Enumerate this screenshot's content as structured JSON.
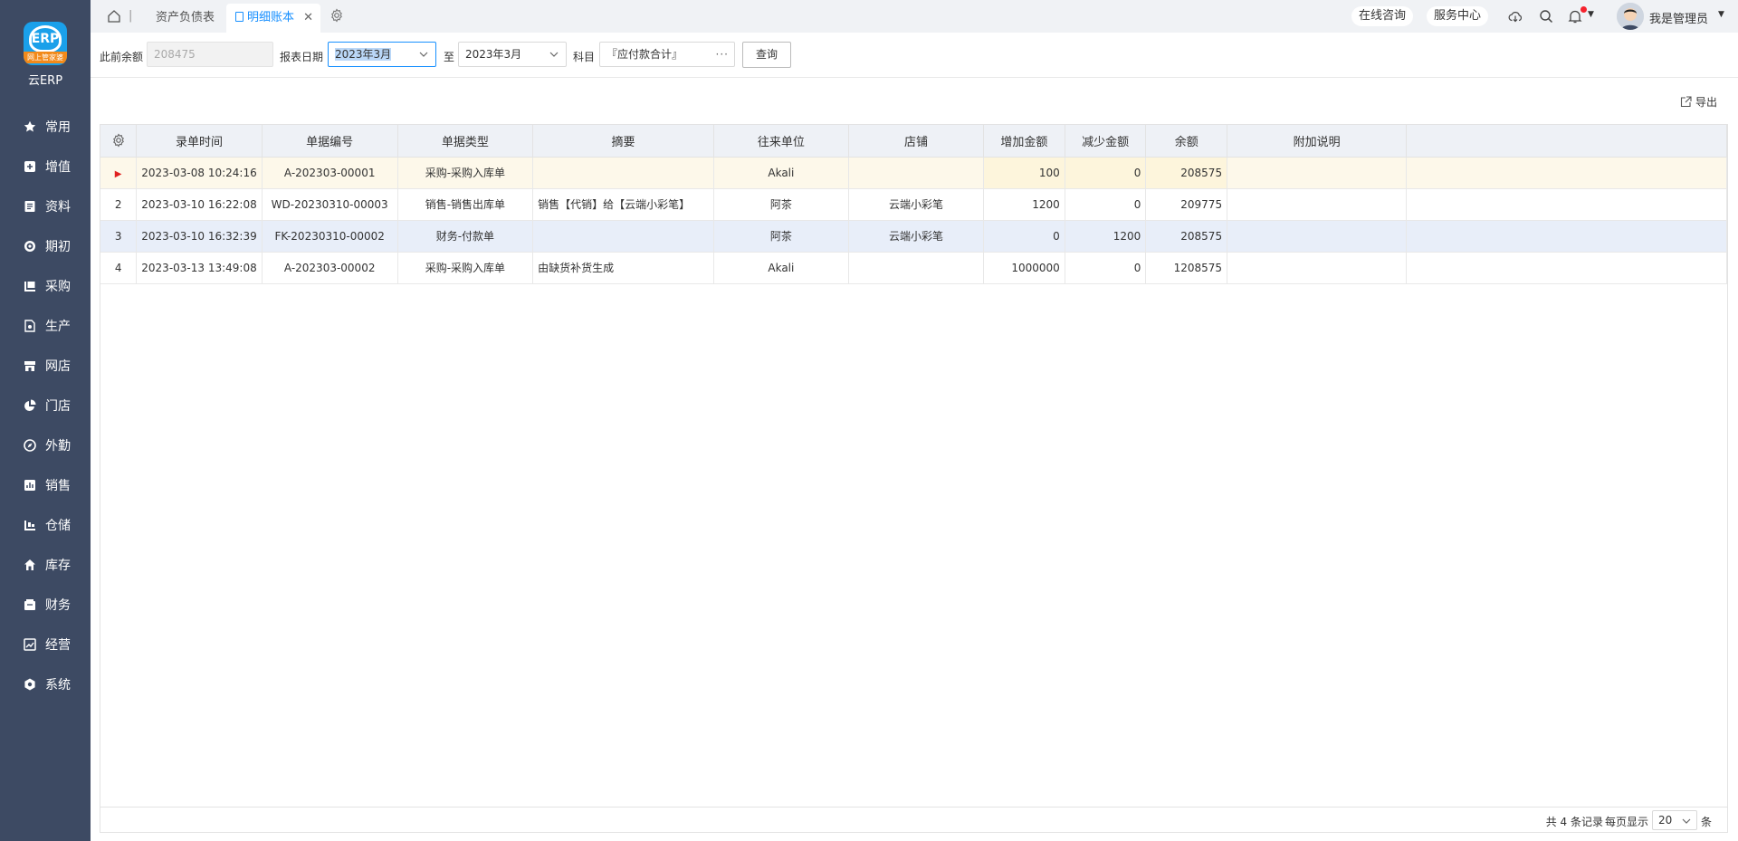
{
  "app": {
    "logo_ribbon": "网上管家婆",
    "logo_mark": "ERP",
    "name": "云ERP"
  },
  "sidebar": {
    "items": [
      {
        "label": "常用",
        "icon": "star-icon"
      },
      {
        "label": "增值",
        "icon": "plus-square-icon"
      },
      {
        "label": "资料",
        "icon": "document-icon"
      },
      {
        "label": "期初",
        "icon": "target-icon"
      },
      {
        "label": "采购",
        "icon": "purchase-icon"
      },
      {
        "label": "生产",
        "icon": "production-icon"
      },
      {
        "label": "网店",
        "icon": "store-icon"
      },
      {
        "label": "门店",
        "icon": "pie-icon"
      },
      {
        "label": "外勤",
        "icon": "compass-icon"
      },
      {
        "label": "销售",
        "icon": "chart-icon"
      },
      {
        "label": "仓储",
        "icon": "warehouse-icon"
      },
      {
        "label": "库存",
        "icon": "home-icon"
      },
      {
        "label": "财务",
        "icon": "finance-icon"
      },
      {
        "label": "经营",
        "icon": "business-icon"
      },
      {
        "label": "系统",
        "icon": "settings-icon"
      }
    ]
  },
  "topbar": {
    "tabs": [
      {
        "label": "资产负债表"
      },
      {
        "label": "明细账本",
        "active": true
      }
    ],
    "consult": "在线咨询",
    "service": "服务中心",
    "user_name": "我是管理员"
  },
  "filters": {
    "prev_balance_label": "此前余额",
    "prev_balance_value": "208475",
    "date_label": "报表日期",
    "date_from": "2023年3月",
    "to_label": "至",
    "date_to": "2023年3月",
    "subject_label": "科目",
    "subject_value": "『应付款合计』",
    "query": "查询"
  },
  "export_label": "导出",
  "table": {
    "columns": [
      "录单时间",
      "单据编号",
      "单据类型",
      "摘要",
      "往来单位",
      "店铺",
      "增加金额",
      "减少金额",
      "余额",
      "附加说明"
    ],
    "rows": [
      {
        "idx": "▶",
        "time": "2023-03-08 10:24:16",
        "no": "A-202303-00001",
        "type": "采购-采购入库单",
        "summary": "",
        "partner": "Akali",
        "shop": "",
        "inc": "100",
        "dec": "0",
        "balance": "208575",
        "note": ""
      },
      {
        "idx": "2",
        "time": "2023-03-10 16:22:08",
        "no": "WD-20230310-00003",
        "type": "销售-销售出库单",
        "summary": "销售【代销】给【云端小彩笔】",
        "partner": "阿茶",
        "shop": "云端小彩笔",
        "inc": "1200",
        "dec": "0",
        "balance": "209775",
        "note": ""
      },
      {
        "idx": "3",
        "time": "2023-03-10 16:32:39",
        "no": "FK-20230310-00002",
        "type": "财务-付款单",
        "summary": "",
        "partner": "阿茶",
        "shop": "云端小彩笔",
        "inc": "0",
        "dec": "1200",
        "balance": "208575",
        "note": ""
      },
      {
        "idx": "4",
        "time": "2023-03-13 13:49:08",
        "no": "A-202303-00002",
        "type": "采购-采购入库单",
        "summary": "由缺货补货生成",
        "partner": "Akali",
        "shop": "",
        "inc": "1000000",
        "dec": "0",
        "balance": "1208575",
        "note": ""
      }
    ]
  },
  "footer": {
    "total_text": "共 4 条记录",
    "per_page_label": "每页显示",
    "page_size": "20",
    "unit": "条"
  },
  "colors": {
    "sidebar": "#3d4a63",
    "accent": "#1890ff",
    "logo": "#1aa0ea",
    "ribbon": "#f28a1a"
  }
}
